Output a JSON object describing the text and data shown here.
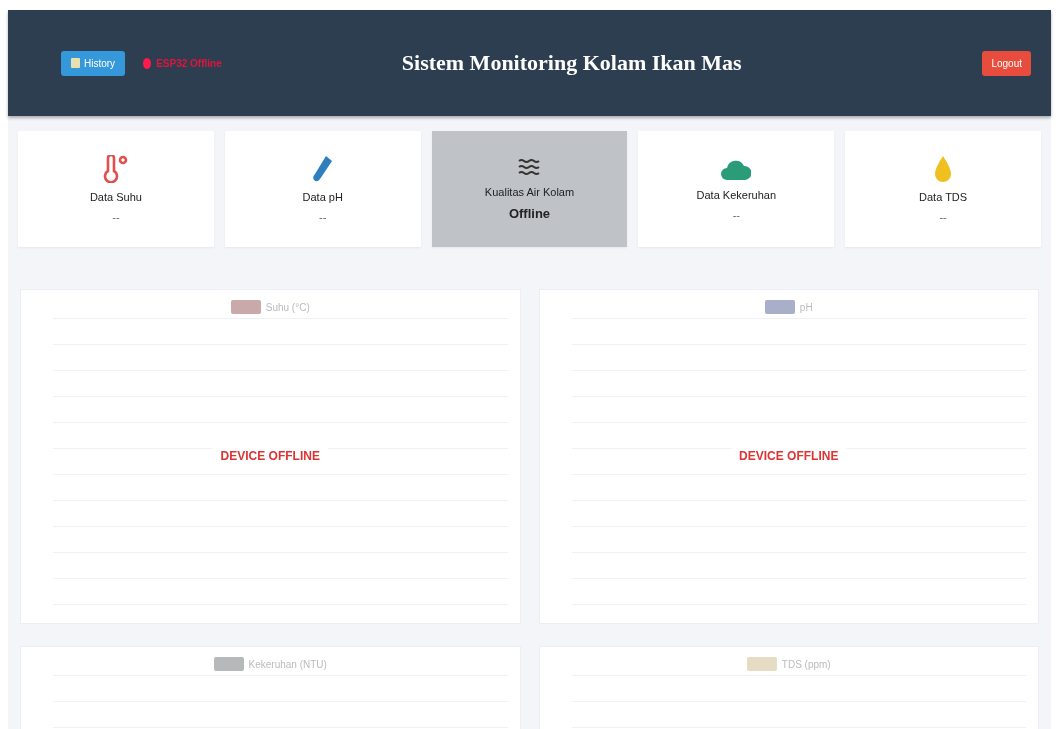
{
  "header": {
    "title": "Sistem Monitoring Kolam Ikan Mas",
    "history_button": "History",
    "status": {
      "text": "ESP32 Offline",
      "online": false
    },
    "logout_button": "Logout"
  },
  "cards": [
    {
      "kind": "thermometer",
      "label": "Data Suhu",
      "value": "--",
      "highlighted": false
    },
    {
      "kind": "tube",
      "label": "Data pH",
      "value": "--",
      "highlighted": false
    },
    {
      "kind": "water",
      "label": "Kualitas Air Kolam",
      "value": "Offline",
      "highlighted": true
    },
    {
      "kind": "cloud",
      "label": "Data Kekeruhan",
      "value": "--",
      "highlighted": false
    },
    {
      "kind": "drop",
      "label": "Data TDS",
      "value": "--",
      "highlighted": false
    }
  ],
  "charts": [
    {
      "legend": "Suhu (°C)",
      "color": "#c9a9a9",
      "overlay": "DEVICE OFFLINE"
    },
    {
      "legend": "pH",
      "color": "#a9aec9",
      "overlay": "DEVICE OFFLINE"
    },
    {
      "legend": "Kekeruhan (NTU)",
      "color": "#b5b9b9"
    },
    {
      "legend": "TDS (ppm)",
      "color": "#e6dcc4"
    }
  ]
}
